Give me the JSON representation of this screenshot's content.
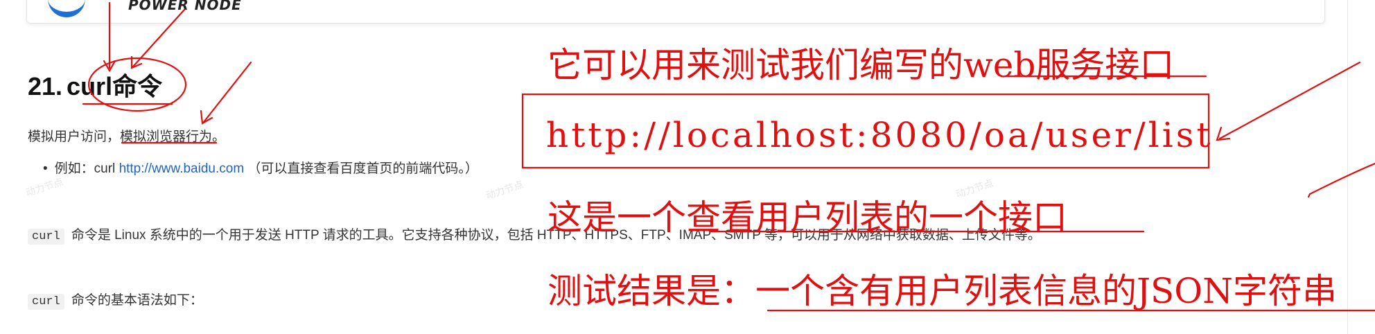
{
  "header_card": {
    "logo_text": "POWER NODE"
  },
  "article": {
    "heading_number": "21.",
    "heading_title": "curl命令",
    "line1": "模拟用户访问，模拟浏览器行为。",
    "bullet_prefix": "例如：curl ",
    "bullet_link": "http://www.baidu.com",
    "bullet_suffix": " （可以直接查看百度首页的前端代码。）",
    "code_curl": "curl",
    "line3": "命令是 Linux 系统中的一个用于发送 HTTP 请求的工具。它支持各种协议，包括 HTTP、HTTPS、FTP、IMAP、SMTP 等，可以用于从网络中获取数据、上传文件等。",
    "line4": "命令的基本语法如下："
  },
  "watermarks": [
    "动力节点",
    "动力节点",
    "动力节点"
  ],
  "annotations": {
    "line1": "它可以用来测试我们编写的web服务接口",
    "url": "http://localhost:8080/oa/user/list",
    "line3": "这是一个查看用户列表的一个接口",
    "line4": "测试结果是：一个含有用户列表信息的JSON字符串"
  },
  "colors": {
    "annotation_red": "#e01010",
    "link_blue": "#1e63c4",
    "logo_blue": "#1e6fd6"
  }
}
